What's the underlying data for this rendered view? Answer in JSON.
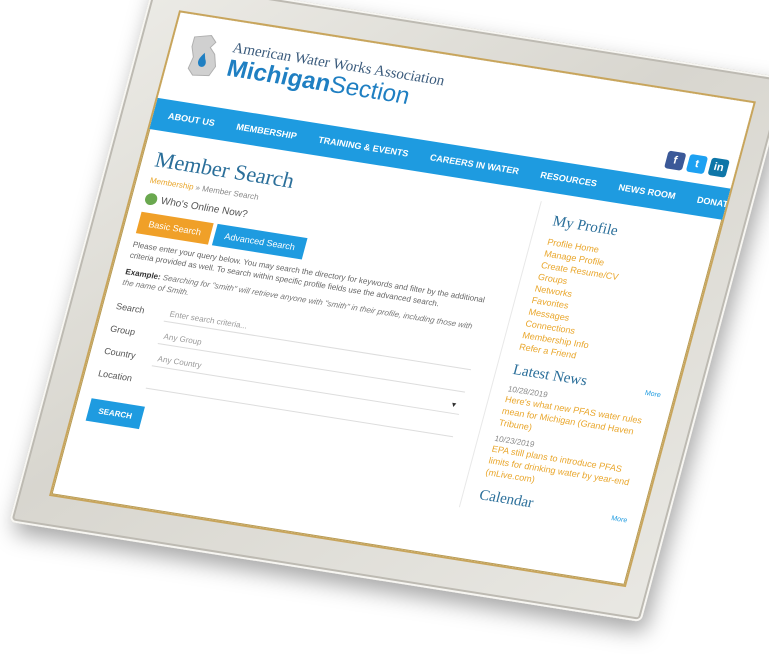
{
  "header": {
    "org_line1": "American Water Works Association",
    "org_line2_bold": "Michigan",
    "org_line2_rest": "Section"
  },
  "nav": {
    "items": [
      "ABOUT US",
      "MEMBERSHIP",
      "TRAINING & EVENTS",
      "CAREERS IN WATER",
      "RESOURCES",
      "NEWS ROOM",
      "DONATIONS"
    ]
  },
  "social": {
    "facebook": "f",
    "twitter": "t",
    "linkedin": "in"
  },
  "main": {
    "title": "Member Search",
    "breadcrumb_link": "Membership",
    "breadcrumb_sep": " » ",
    "breadcrumb_current": "Member Search",
    "online": "Who's Online Now?",
    "tabs": [
      "Basic Search",
      "Advanced Search"
    ],
    "intro": "Please enter your query below. You may search the directory for keywords and filter by the additional criteria provided as well. To search within specific profile fields use the advanced search.",
    "example_label": "Example:",
    "example_text": "Searching for \"smith\" will retrieve anyone with \"smith\" in their profile, including those with the name of Smith.",
    "form": {
      "search_label": "Search",
      "search_placeholder": "Enter search criteria...",
      "group_label": "Group",
      "group_value": "Any Group",
      "country_label": "Country",
      "country_value": "Any Country",
      "location_label": "Location",
      "location_value": ""
    },
    "search_button": "SEARCH"
  },
  "sidebar": {
    "profile_heading": "My Profile",
    "profile_links": [
      "Profile Home",
      "Manage Profile",
      "Create Resume/CV",
      "Groups",
      "Networks",
      "Favorites",
      "Messages",
      "Connections",
      "Membership Info",
      "Refer a Friend"
    ],
    "news_heading": "Latest News",
    "more_label": "More",
    "news": [
      {
        "date": "10/28/2019",
        "title": "Here's what new PFAS water rules mean for Michigan (Grand Haven Tribune)"
      },
      {
        "date": "10/23/2019",
        "title": "EPA still plans to introduce PFAS limits for drinking water by year-end (mLive.com)"
      }
    ],
    "calendar_heading": "Calendar",
    "calendar_more": "More"
  },
  "colors": {
    "nav_blue": "#1e9be0",
    "accent_orange": "#f0a028",
    "link_orange": "#e9a62b",
    "title_blue": "#2b6f9a"
  }
}
